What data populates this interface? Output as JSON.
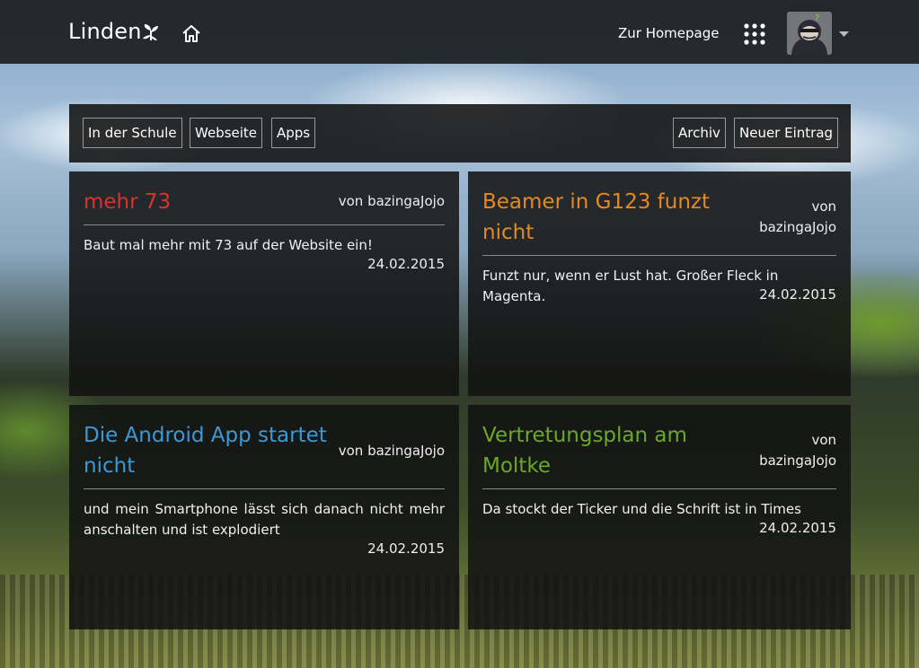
{
  "header": {
    "brand": "Linden",
    "homepage_link": "Zur Homepage"
  },
  "toolbar": {
    "left_buttons": [
      "In der Schule",
      "Webseite",
      "Apps"
    ],
    "archive_label": "Archiv",
    "new_entry_label": "Neuer Eintrag"
  },
  "posts": [
    {
      "title": "mehr 73",
      "author": "von bazingaJojo",
      "body": "Baut mal mehr mit 73 auf der Website ein!",
      "date": "24.02.2015",
      "color": "#d9342b"
    },
    {
      "title": "Beamer in G123 funzt nicht",
      "author": "von bazingaJojo",
      "body": "Funzt nur, wenn er Lust hat. Großer Fleck in Magenta.",
      "date": "24.02.2015",
      "color": "#e68a1f"
    },
    {
      "title": "Die Android App startet nicht",
      "author": "von bazingaJojo",
      "body": "und mein Smartphone lässt sich danach nicht mehr anschalten und ist explodiert",
      "date": "24.02.2015",
      "color": "#3a9ad9"
    },
    {
      "title": "Vertretungsplan am Moltke",
      "author": "von bazingaJojo",
      "body": "Da stockt der Ticker und die Schrift ist in Times",
      "date": "24.02.2015",
      "color": "#6aa82a"
    }
  ]
}
